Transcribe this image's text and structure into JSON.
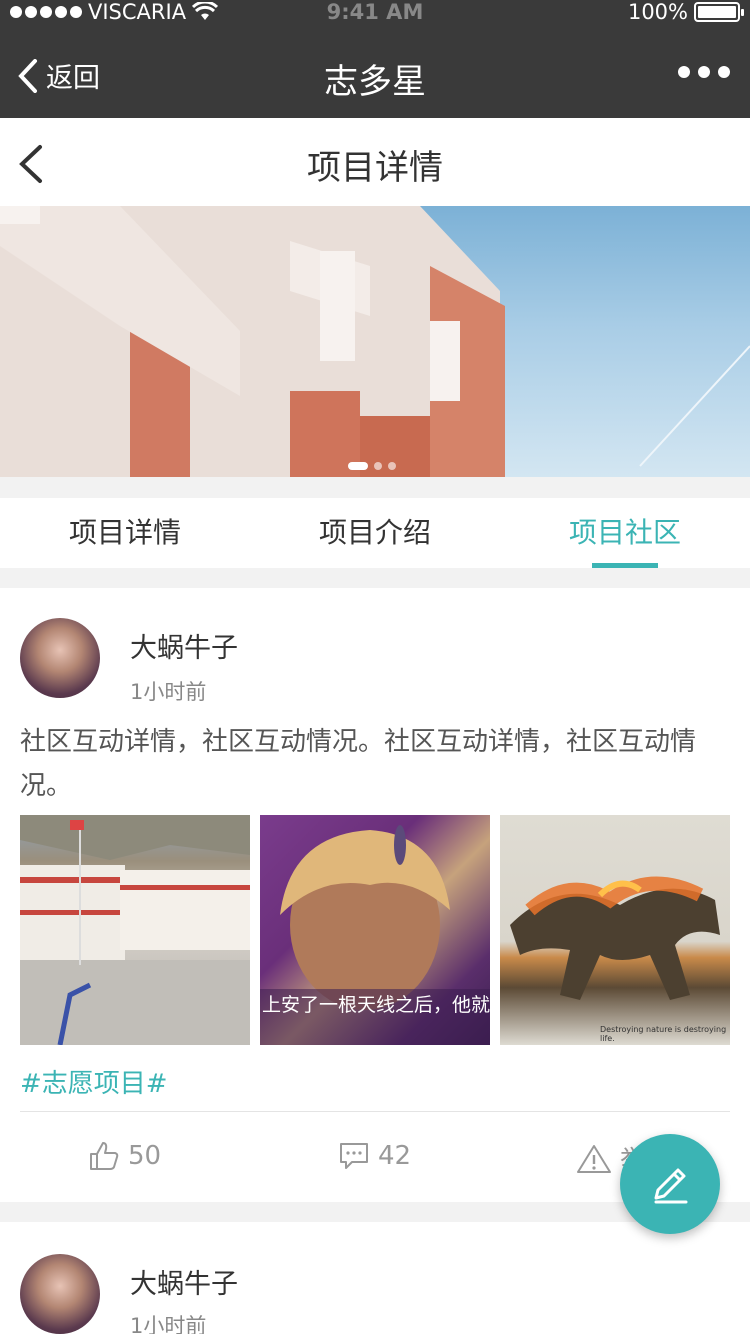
{
  "status_bar": {
    "carrier": "VISCARIA",
    "time": "9:41 AM",
    "battery": "100%"
  },
  "wx_nav": {
    "back_label": "返回",
    "title": "志多星"
  },
  "page_header": {
    "title": "项目详情"
  },
  "banner": {
    "slide_count": 3,
    "active_slide": 1
  },
  "tabs": [
    {
      "label": "项目详情",
      "active": false
    },
    {
      "label": "项目介绍",
      "active": false
    },
    {
      "label": "项目社区",
      "active": true
    }
  ],
  "posts": [
    {
      "author": "大蜗牛子",
      "time": "1小时前",
      "content": "社区互动详情，社区互动情况。社区互动详情，社区互动情况。",
      "photo_caption": "上安了一根天线之后，他就颜色",
      "photo_note": "Destroying nature is destroying life.",
      "tag": "#志愿项目#",
      "likes": "50",
      "comments": "42",
      "report_label": "举"
    },
    {
      "author": "大蜗牛子",
      "time": "1小时前"
    }
  ],
  "colors": {
    "accent": "#3bb4b4",
    "nav_bg": "#3a3a3a"
  },
  "icons": {
    "fab": "edit-pencil-icon"
  }
}
